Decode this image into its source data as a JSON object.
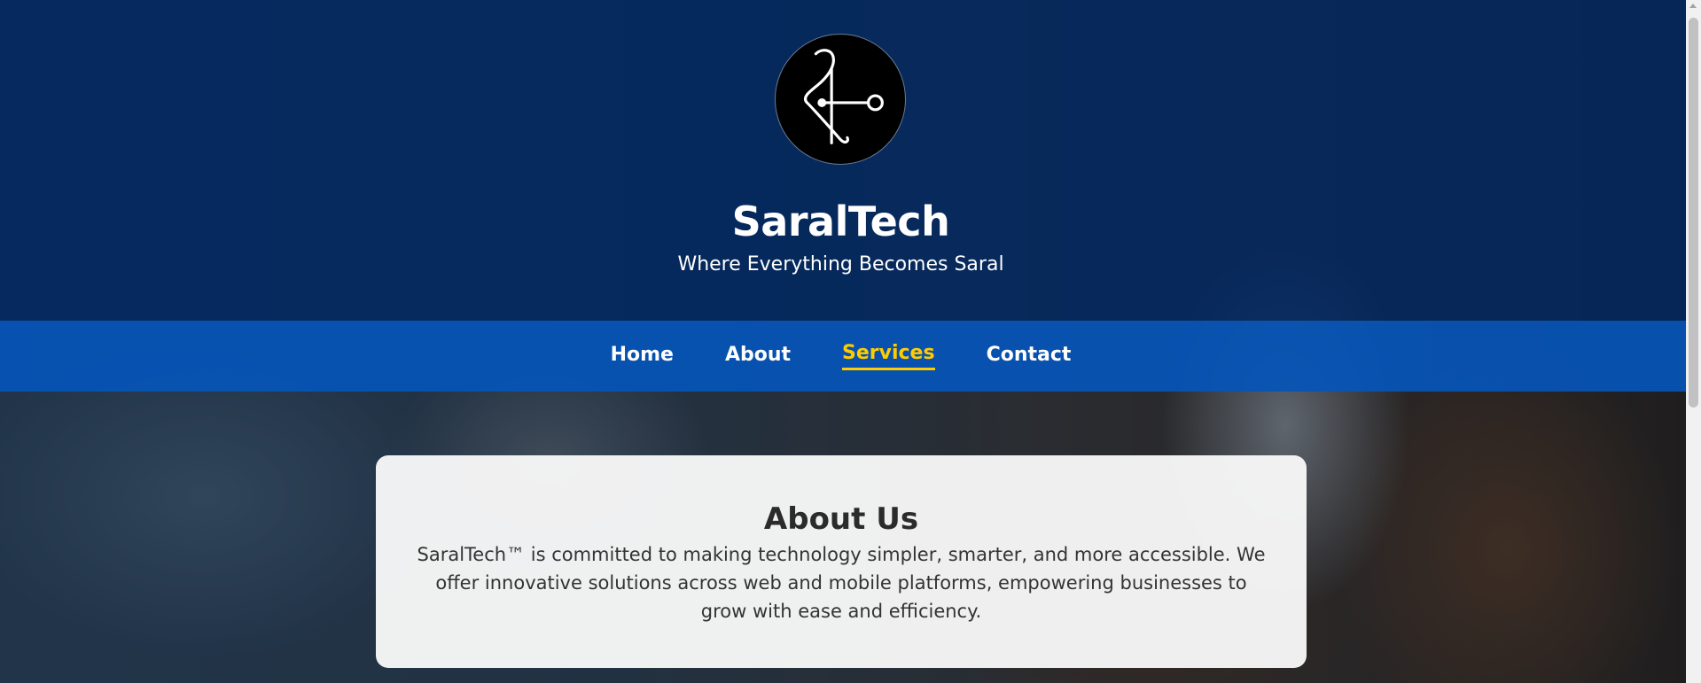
{
  "header": {
    "logo_icon": "saraltech-logo",
    "title": "SaralTech",
    "tagline": "Where Everything Becomes Saral"
  },
  "nav": {
    "items": [
      {
        "label": "Home",
        "active": false
      },
      {
        "label": "About",
        "active": false
      },
      {
        "label": "Services",
        "active": true
      },
      {
        "label": "Contact",
        "active": false
      }
    ]
  },
  "about": {
    "title": "About Us",
    "body": "SaralTech™ is committed to making technology simpler, smarter, and more accessible. We offer innovative solutions across web and mobile platforms, empowering businesses to grow with ease and efficiency."
  },
  "colors": {
    "header_bg": "#00286a",
    "nav_bg": "#0555b9",
    "nav_active": "#ffcc00",
    "card_bg": "#f8f8f8"
  }
}
